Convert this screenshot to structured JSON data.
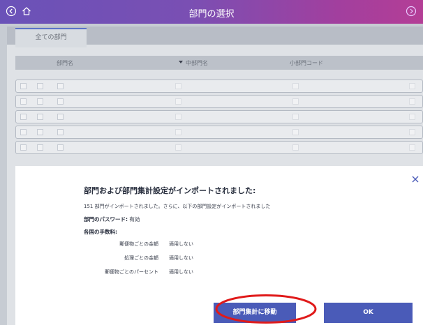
{
  "header": {
    "title": "部門の選択",
    "back_icon": "back-circle-icon",
    "home_icon": "home-icon",
    "info_icon": "info-circle-icon"
  },
  "tabs": [
    {
      "label": "全ての部門"
    }
  ],
  "table": {
    "columns": [
      "部門名",
      "中部門名",
      "小部門コード"
    ],
    "sort_icon": "sort-down-icon",
    "rows": 5
  },
  "dialog": {
    "title": "部門および部門集計設定がインポートされました:",
    "summary": "151 部門がインポートされました。さらに、以下の部門設定がインポートされました",
    "password_label": "部門のパスワード:",
    "password_value": "有効",
    "fees_heading": "各国の手数料:",
    "fees": [
      {
        "label": "郵便物ごとの金額",
        "value": "適用しない"
      },
      {
        "label": "処理ごとの金額",
        "value": "適用しない"
      },
      {
        "label": "郵便物ごとのパーセント",
        "value": "適用しない"
      }
    ],
    "buttons": {
      "move": "部門集計に移動",
      "ok": "OK"
    },
    "highlight_color": "#e01a1a"
  },
  "colors": {
    "header_gradient_start": "#6a52b8",
    "header_gradient_end": "#b43e96",
    "button": "#4a5bb8",
    "tab_accent": "#5a73c7"
  }
}
